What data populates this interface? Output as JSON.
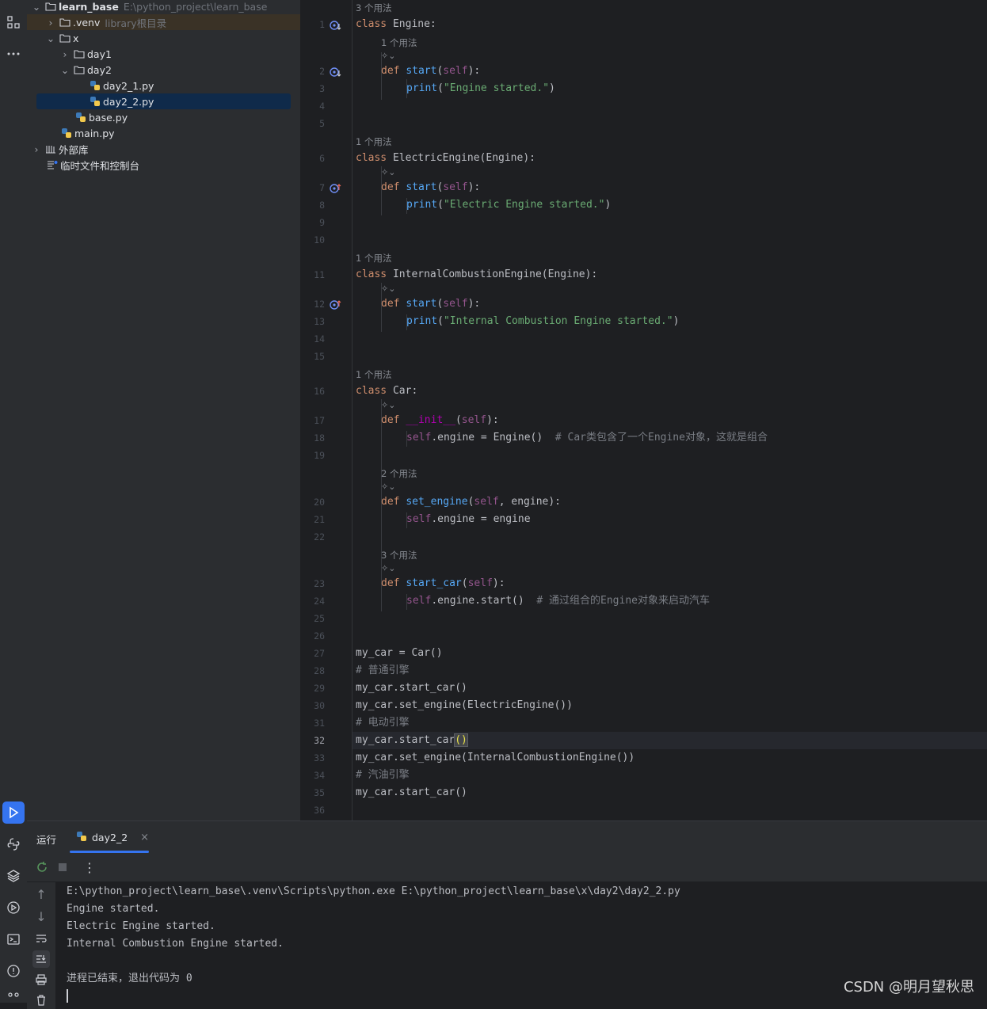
{
  "project": {
    "root": {
      "name": "learn_base",
      "path": "E:\\python_project\\learn_base"
    },
    "venv": {
      "name": ".venv",
      "hint": "library根目录"
    },
    "x": "x",
    "day1": "day1",
    "day2": "day2",
    "file1": "day2_1.py",
    "file2": "day2_2.py",
    "base": "base.py",
    "main": "main.py",
    "external": "外部库",
    "scratch": "临时文件和控制台"
  },
  "editor": {
    "current_line": 32,
    "hints": {
      "h3": "3 个用法",
      "h1": "1 个用法",
      "h2": "2 个用法"
    },
    "code": {
      "l1": {
        "kw": "class",
        "rest": " Engine:"
      },
      "l2": {
        "kw": "def",
        "fn": "start",
        "a": "(",
        "self": "self",
        "b": "):"
      },
      "l3": {
        "fn": "print",
        "a": "(",
        "s": "\"Engine started.\"",
        "b": ")"
      },
      "l6": {
        "kw": "class",
        "rest": " ElectricEngine(Engine):"
      },
      "l7": {
        "kw": "def",
        "fn": "start",
        "a": "(",
        "self": "self",
        "b": "):"
      },
      "l8": {
        "fn": "print",
        "a": "(",
        "s": "\"Electric Engine started.\"",
        "b": ")"
      },
      "l11": {
        "kw": "class",
        "rest": " InternalCombustionEngine(Engine):"
      },
      "l12": {
        "kw": "def",
        "fn": "start",
        "a": "(",
        "self": "self",
        "b": "):"
      },
      "l13": {
        "fn": "print",
        "a": "(",
        "s": "\"Internal Combustion Engine started.\"",
        "b": ")"
      },
      "l16": {
        "kw": "class",
        "rest": " Car:"
      },
      "l17": {
        "kw": "def",
        "fn": "__init__",
        "a": "(",
        "self": "self",
        "b": "):"
      },
      "l18": {
        "self": "self",
        "rest": ".engine = Engine()  ",
        "cm": "# Car类包含了一个Engine对象，这就是组合"
      },
      "l20": {
        "kw": "def",
        "fn": "set_engine",
        "a": "(",
        "self": "self",
        "b": ", engine):"
      },
      "l21": {
        "self": "self",
        "rest": ".engine = engine"
      },
      "l23": {
        "kw": "def",
        "fn": "start_car",
        "a": "(",
        "self": "self",
        "b": "):"
      },
      "l24": {
        "self": "self",
        "rest": ".engine.start()  ",
        "cm": "# 通过组合的Engine对象来启动汽车"
      },
      "l27": "my_car = Car()",
      "l28": "# 普通引擎",
      "l29": "my_car.start_car()",
      "l30": "my_car.set_engine(ElectricEngine())",
      "l31": "# 电动引擎",
      "l32": {
        "a": "my_car.start_car",
        "b": "()"
      },
      "l33": "my_car.set_engine(InternalCombustionEngine())",
      "l34": "# 汽油引擎",
      "l35": "my_car.start_car()"
    },
    "line_numbers": [
      "1",
      "2",
      "3",
      "4",
      "5",
      "6",
      "7",
      "8",
      "9",
      "10",
      "11",
      "12",
      "13",
      "14",
      "15",
      "16",
      "17",
      "18",
      "19",
      "20",
      "21",
      "22",
      "23",
      "24",
      "25",
      "26",
      "27",
      "28",
      "29",
      "30",
      "31",
      "32",
      "33",
      "34",
      "35",
      "36"
    ]
  },
  "run": {
    "title": "运行",
    "tab": "day2_2",
    "close": "×",
    "output": [
      "E:\\python_project\\learn_base\\.venv\\Scripts\\python.exe E:\\python_project\\learn_base\\x\\day2\\day2_2.py",
      "Engine started.",
      "Electric Engine started.",
      "Internal Combustion Engine started.",
      "",
      "进程已结束，退出代码为 0"
    ]
  },
  "watermark": "CSDN @明月望秋思",
  "colors": {
    "accent": "#3574f0",
    "keyword": "#cf8e6d",
    "function": "#56a8f5",
    "string": "#6aab73",
    "self": "#94558d"
  }
}
